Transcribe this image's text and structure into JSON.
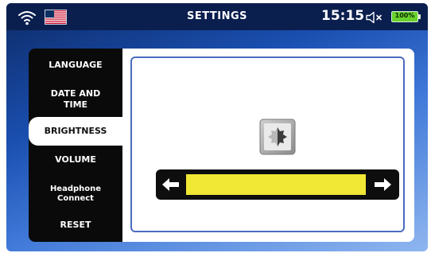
{
  "status_bar": {
    "title": "SETTINGS",
    "time": "15:15",
    "battery": "100%",
    "icons": [
      "wifi-icon",
      "us-flag-icon",
      "speaker-muted-icon",
      "battery-icon"
    ]
  },
  "tabs": [
    {
      "label": "LANGUAGE",
      "active": false
    },
    {
      "label": "DATE AND\nTIME",
      "active": false
    },
    {
      "label": "BRIGHTNESS",
      "active": true
    },
    {
      "label": "VOLUME",
      "active": false
    },
    {
      "label": "Headphone\nConnect",
      "active": false
    },
    {
      "label": "RESET",
      "active": false
    }
  ],
  "brightness": {
    "icon": "brightness-icon",
    "level": 1.0,
    "decrease_icon": "arrow-left-icon",
    "increase_icon": "arrow-right-icon",
    "fill_color": "#f1e735"
  },
  "colors": {
    "accent": "#4a6cc0",
    "status_bar": "#0b1f4f",
    "battery": "#69d12c"
  }
}
